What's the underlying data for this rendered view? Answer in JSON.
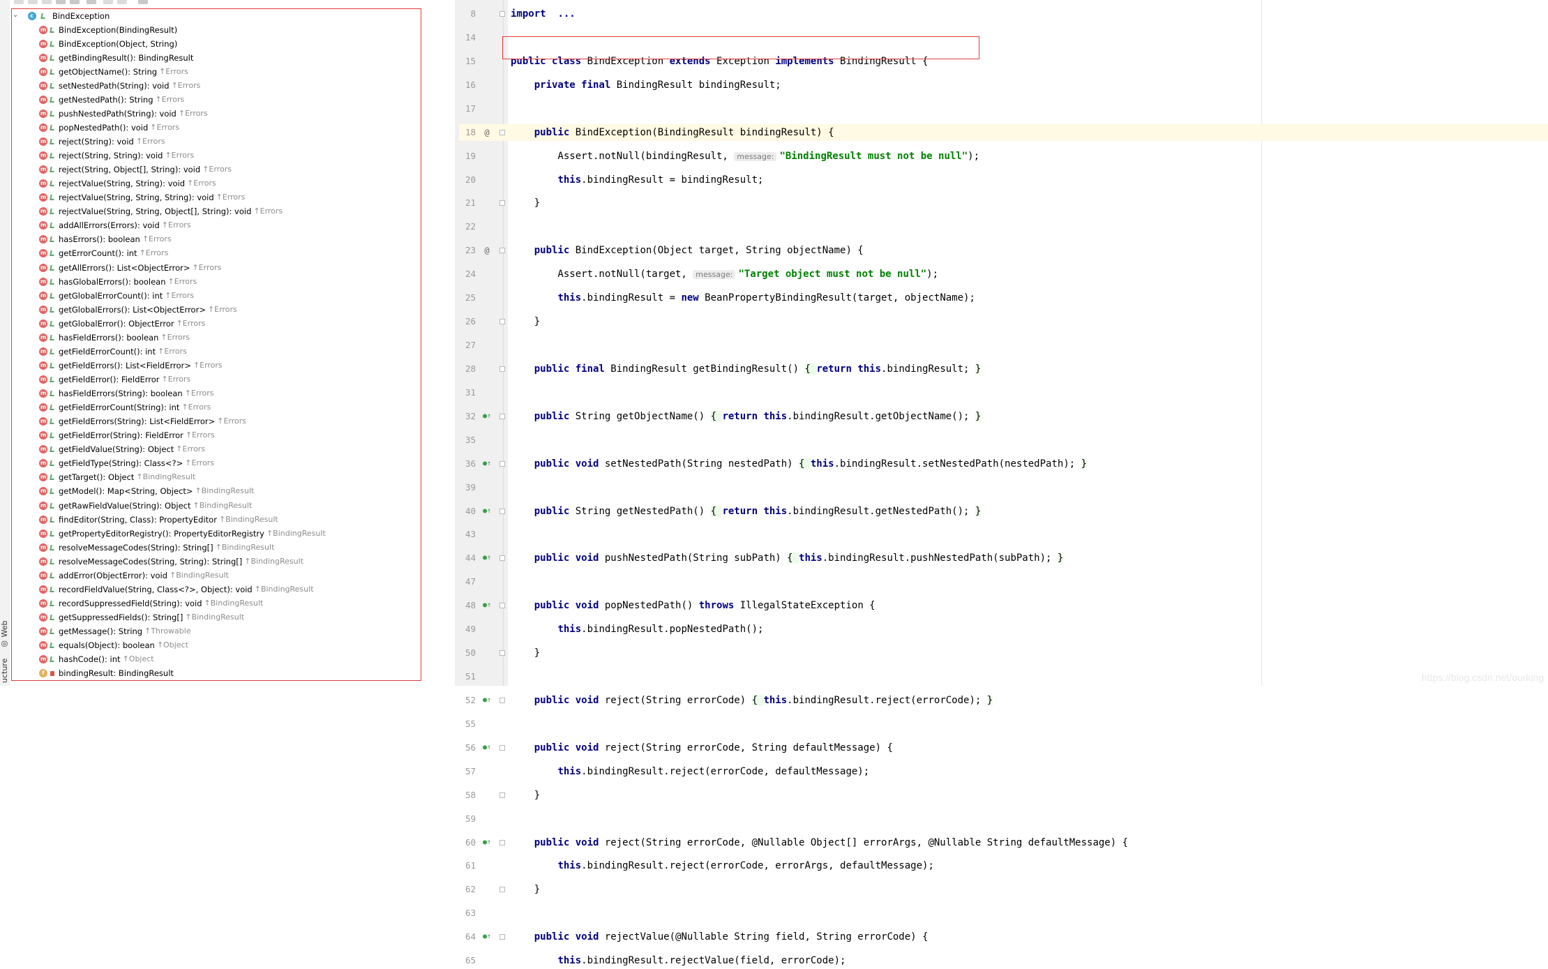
{
  "left_strip": {
    "tabs": [
      "Web",
      "ucture"
    ]
  },
  "structure": {
    "root": {
      "name": "BindException"
    },
    "items": [
      {
        "icon": "method",
        "vis": "public",
        "name": "BindException(BindingResult)",
        "origin": ""
      },
      {
        "icon": "method",
        "vis": "public",
        "name": "BindException(Object, String)",
        "origin": ""
      },
      {
        "icon": "method",
        "vis": "public",
        "name": "getBindingResult(): BindingResult",
        "origin": ""
      },
      {
        "icon": "method",
        "vis": "public",
        "name": "getObjectName(): String",
        "origin": "↑Errors"
      },
      {
        "icon": "method",
        "vis": "public",
        "name": "setNestedPath(String): void",
        "origin": "↑Errors"
      },
      {
        "icon": "method",
        "vis": "public",
        "name": "getNestedPath(): String",
        "origin": "↑Errors"
      },
      {
        "icon": "method",
        "vis": "public",
        "name": "pushNestedPath(String): void",
        "origin": "↑Errors"
      },
      {
        "icon": "method",
        "vis": "public",
        "name": "popNestedPath(): void",
        "origin": "↑Errors"
      },
      {
        "icon": "method",
        "vis": "public",
        "name": "reject(String): void",
        "origin": "↑Errors"
      },
      {
        "icon": "method",
        "vis": "public",
        "name": "reject(String, String): void",
        "origin": "↑Errors"
      },
      {
        "icon": "method",
        "vis": "public",
        "name": "reject(String, Object[], String): void",
        "origin": "↑Errors"
      },
      {
        "icon": "method",
        "vis": "public",
        "name": "rejectValue(String, String): void",
        "origin": "↑Errors"
      },
      {
        "icon": "method",
        "vis": "public",
        "name": "rejectValue(String, String, String): void",
        "origin": "↑Errors"
      },
      {
        "icon": "method",
        "vis": "public",
        "name": "rejectValue(String, String, Object[], String): void",
        "origin": "↑Errors"
      },
      {
        "icon": "method",
        "vis": "public",
        "name": "addAllErrors(Errors): void",
        "origin": "↑Errors"
      },
      {
        "icon": "method",
        "vis": "public",
        "name": "hasErrors(): boolean",
        "origin": "↑Errors"
      },
      {
        "icon": "method",
        "vis": "public",
        "name": "getErrorCount(): int",
        "origin": "↑Errors"
      },
      {
        "icon": "method",
        "vis": "public",
        "name": "getAllErrors(): List<ObjectError>",
        "origin": "↑Errors"
      },
      {
        "icon": "method",
        "vis": "public",
        "name": "hasGlobalErrors(): boolean",
        "origin": "↑Errors"
      },
      {
        "icon": "method",
        "vis": "public",
        "name": "getGlobalErrorCount(): int",
        "origin": "↑Errors"
      },
      {
        "icon": "method",
        "vis": "public",
        "name": "getGlobalErrors(): List<ObjectError>",
        "origin": "↑Errors"
      },
      {
        "icon": "method",
        "vis": "public",
        "name": "getGlobalError(): ObjectError",
        "origin": "↑Errors"
      },
      {
        "icon": "method",
        "vis": "public",
        "name": "hasFieldErrors(): boolean",
        "origin": "↑Errors"
      },
      {
        "icon": "method",
        "vis": "public",
        "name": "getFieldErrorCount(): int",
        "origin": "↑Errors"
      },
      {
        "icon": "method",
        "vis": "public",
        "name": "getFieldErrors(): List<FieldError>",
        "origin": "↑Errors"
      },
      {
        "icon": "method",
        "vis": "public",
        "name": "getFieldError(): FieldError",
        "origin": "↑Errors"
      },
      {
        "icon": "method",
        "vis": "public",
        "name": "hasFieldErrors(String): boolean",
        "origin": "↑Errors"
      },
      {
        "icon": "method",
        "vis": "public",
        "name": "getFieldErrorCount(String): int",
        "origin": "↑Errors"
      },
      {
        "icon": "method",
        "vis": "public",
        "name": "getFieldErrors(String): List<FieldError>",
        "origin": "↑Errors"
      },
      {
        "icon": "method",
        "vis": "public",
        "name": "getFieldError(String): FieldError",
        "origin": "↑Errors"
      },
      {
        "icon": "method",
        "vis": "public",
        "name": "getFieldValue(String): Object",
        "origin": "↑Errors"
      },
      {
        "icon": "method",
        "vis": "public",
        "name": "getFieldType(String): Class<?>",
        "origin": "↑Errors"
      },
      {
        "icon": "method",
        "vis": "public",
        "name": "getTarget(): Object",
        "origin": "↑BindingResult"
      },
      {
        "icon": "method",
        "vis": "public",
        "name": "getModel(): Map<String, Object>",
        "origin": "↑BindingResult"
      },
      {
        "icon": "method",
        "vis": "public",
        "name": "getRawFieldValue(String): Object",
        "origin": "↑BindingResult"
      },
      {
        "icon": "method",
        "vis": "public",
        "name": "findEditor(String, Class): PropertyEditor",
        "origin": "↑BindingResult"
      },
      {
        "icon": "method",
        "vis": "public",
        "name": "getPropertyEditorRegistry(): PropertyEditorRegistry",
        "origin": "↑BindingResult"
      },
      {
        "icon": "method",
        "vis": "public",
        "name": "resolveMessageCodes(String): String[]",
        "origin": "↑BindingResult"
      },
      {
        "icon": "method",
        "vis": "public",
        "name": "resolveMessageCodes(String, String): String[]",
        "origin": "↑BindingResult"
      },
      {
        "icon": "method",
        "vis": "public",
        "name": "addError(ObjectError): void",
        "origin": "↑BindingResult"
      },
      {
        "icon": "method",
        "vis": "public",
        "name": "recordFieldValue(String, Class<?>, Object): void",
        "origin": "↑BindingResult"
      },
      {
        "icon": "method",
        "vis": "public",
        "name": "recordSuppressedField(String): void",
        "origin": "↑BindingResult"
      },
      {
        "icon": "method",
        "vis": "public",
        "name": "getSuppressedFields(): String[]",
        "origin": "↑BindingResult"
      },
      {
        "icon": "method",
        "vis": "public",
        "name": "getMessage(): String",
        "origin": "↑Throwable"
      },
      {
        "icon": "method",
        "vis": "public",
        "name": "equals(Object): boolean",
        "origin": "↑Object"
      },
      {
        "icon": "method",
        "vis": "public",
        "name": "hashCode(): int",
        "origin": "↑Object"
      },
      {
        "icon": "field",
        "vis": "private",
        "name": "bindingResult: BindingResult",
        "origin": ""
      }
    ]
  },
  "editor": {
    "watermark": "https://blog.csdn.net/ourking",
    "lines": [
      {
        "n": "8",
        "slot": 0,
        "g": "",
        "fold": true,
        "tokens": [
          [
            "kw",
            "import"
          ],
          [
            "",
            "  "
          ],
          [
            "kw",
            "..."
          ]
        ]
      },
      {
        "n": "14",
        "slot": 1,
        "g": "",
        "fold": false,
        "tokens": []
      },
      {
        "n": "15",
        "slot": 2,
        "g": "",
        "fold": false,
        "tokens": [
          [
            "kw",
            "public class"
          ],
          [
            "",
            " BindException "
          ],
          [
            "kw",
            "extends"
          ],
          [
            "",
            " Exception "
          ],
          [
            "kw",
            "implements"
          ],
          [
            "",
            " BindingResult {"
          ]
        ]
      },
      {
        "n": "16",
        "slot": 3,
        "g": "",
        "fold": false,
        "tokens": [
          [
            "",
            "    "
          ],
          [
            "kw",
            "private final"
          ],
          [
            "",
            " BindingResult bindingResult;"
          ]
        ]
      },
      {
        "n": "17",
        "slot": 4,
        "g": "",
        "fold": false,
        "tokens": []
      },
      {
        "n": "18",
        "slot": 5,
        "g": "@",
        "fold": true,
        "caret": true,
        "tokens": [
          [
            "",
            "    "
          ],
          [
            "kw",
            "public"
          ],
          [
            "",
            " BindException(BindingResult bindingResult) {"
          ]
        ]
      },
      {
        "n": "19",
        "slot": 6,
        "g": "",
        "fold": false,
        "tokens": [
          [
            "",
            "        Assert.notNull(bindingResult, "
          ],
          [
            "hint",
            "message:"
          ],
          [
            "str",
            "\"BindingResult must not be null\""
          ],
          [
            "",
            ");"
          ]
        ]
      },
      {
        "n": "20",
        "slot": 7,
        "g": "",
        "fold": false,
        "tokens": [
          [
            "",
            "        "
          ],
          [
            "kw",
            "this"
          ],
          [
            "",
            ".bindingResult = bindingResult;"
          ]
        ]
      },
      {
        "n": "21",
        "slot": 8,
        "g": "",
        "fold": true,
        "tokens": [
          [
            "",
            "    }"
          ]
        ]
      },
      {
        "n": "22",
        "slot": 9,
        "g": "",
        "fold": false,
        "tokens": []
      },
      {
        "n": "23",
        "slot": 10,
        "g": "@",
        "fold": true,
        "tokens": [
          [
            "",
            "    "
          ],
          [
            "kw",
            "public"
          ],
          [
            "",
            " BindException(Object target, String objectName) {"
          ]
        ]
      },
      {
        "n": "24",
        "slot": 11,
        "g": "",
        "fold": false,
        "tokens": [
          [
            "",
            "        Assert.notNull(target, "
          ],
          [
            "hint",
            "message:"
          ],
          [
            "str",
            "\"Target object must not be null\""
          ],
          [
            "",
            ");"
          ]
        ]
      },
      {
        "n": "25",
        "slot": 12,
        "g": "",
        "fold": false,
        "tokens": [
          [
            "",
            "        "
          ],
          [
            "kw",
            "this"
          ],
          [
            "",
            ".bindingResult = "
          ],
          [
            "kw",
            "new"
          ],
          [
            "",
            " BeanPropertyBindingResult(target, objectName);"
          ]
        ]
      },
      {
        "n": "26",
        "slot": 13,
        "g": "",
        "fold": true,
        "tokens": [
          [
            "",
            "    }"
          ]
        ]
      },
      {
        "n": "27",
        "slot": 14,
        "g": "",
        "fold": false,
        "tokens": []
      },
      {
        "n": "28",
        "slot": 15,
        "g": "",
        "fold": true,
        "tokens": [
          [
            "",
            "    "
          ],
          [
            "kw",
            "public final"
          ],
          [
            "",
            " BindingResult getBindingResult() "
          ],
          [
            "brace",
            "{ "
          ],
          [
            "kw",
            "return this"
          ],
          [
            "",
            ".bindingResult; "
          ],
          [
            "brace",
            "}"
          ]
        ]
      },
      {
        "n": "31",
        "slot": 16,
        "g": "",
        "fold": false,
        "tokens": []
      },
      {
        "n": "32",
        "slot": 17,
        "g": "impl",
        "fold": true,
        "tokens": [
          [
            "",
            "    "
          ],
          [
            "kw",
            "public"
          ],
          [
            "",
            " String getObjectName() "
          ],
          [
            "brace",
            "{ "
          ],
          [
            "kw",
            "return this"
          ],
          [
            "",
            ".bindingResult.getObjectName(); "
          ],
          [
            "brace",
            "}"
          ]
        ]
      },
      {
        "n": "35",
        "slot": 18,
        "g": "",
        "fold": false,
        "tokens": []
      },
      {
        "n": "36",
        "slot": 19,
        "g": "impl",
        "fold": true,
        "tokens": [
          [
            "",
            "    "
          ],
          [
            "kw",
            "public void"
          ],
          [
            "",
            " setNestedPath(String nestedPath) "
          ],
          [
            "brace",
            "{ "
          ],
          [
            "kw",
            "this"
          ],
          [
            "",
            ".bindingResult.setNestedPath(nestedPath); "
          ],
          [
            "brace",
            "}"
          ]
        ]
      },
      {
        "n": "39",
        "slot": 20,
        "g": "",
        "fold": false,
        "tokens": []
      },
      {
        "n": "40",
        "slot": 21,
        "g": "impl",
        "fold": true,
        "tokens": [
          [
            "",
            "    "
          ],
          [
            "kw",
            "public"
          ],
          [
            "",
            " String getNestedPath() "
          ],
          [
            "brace",
            "{ "
          ],
          [
            "kw",
            "return this"
          ],
          [
            "",
            ".bindingResult.getNestedPath(); "
          ],
          [
            "brace",
            "}"
          ]
        ]
      },
      {
        "n": "43",
        "slot": 22,
        "g": "",
        "fold": false,
        "tokens": []
      },
      {
        "n": "44",
        "slot": 23,
        "g": "impl",
        "fold": true,
        "tokens": [
          [
            "",
            "    "
          ],
          [
            "kw",
            "public void"
          ],
          [
            "",
            " pushNestedPath(String subPath) "
          ],
          [
            "brace",
            "{ "
          ],
          [
            "kw",
            "this"
          ],
          [
            "",
            ".bindingResult.pushNestedPath(subPath); "
          ],
          [
            "brace",
            "}"
          ]
        ]
      },
      {
        "n": "47",
        "slot": 24,
        "g": "",
        "fold": false,
        "tokens": []
      },
      {
        "n": "48",
        "slot": 25,
        "g": "impl",
        "fold": true,
        "tokens": [
          [
            "",
            "    "
          ],
          [
            "kw",
            "public void"
          ],
          [
            "",
            " popNestedPath() "
          ],
          [
            "kw",
            "throws"
          ],
          [
            "",
            " IllegalStateException {"
          ]
        ]
      },
      {
        "n": "49",
        "slot": 26,
        "g": "",
        "fold": false,
        "tokens": [
          [
            "",
            "        "
          ],
          [
            "kw",
            "this"
          ],
          [
            "",
            ".bindingResult.popNestedPath();"
          ]
        ]
      },
      {
        "n": "50",
        "slot": 27,
        "g": "",
        "fold": true,
        "tokens": [
          [
            "",
            "    }"
          ]
        ]
      },
      {
        "n": "51",
        "slot": 28,
        "g": "",
        "fold": false,
        "tokens": []
      },
      {
        "n": "52",
        "slot": 29,
        "g": "impl",
        "fold": true,
        "tokens": [
          [
            "",
            "    "
          ],
          [
            "kw",
            "public void"
          ],
          [
            "",
            " reject(String errorCode) "
          ],
          [
            "brace",
            "{ "
          ],
          [
            "kw",
            "this"
          ],
          [
            "",
            ".bindingResult.reject(errorCode); "
          ],
          [
            "brace",
            "}"
          ]
        ]
      },
      {
        "n": "55",
        "slot": 30,
        "g": "",
        "fold": false,
        "tokens": []
      },
      {
        "n": "56",
        "slot": 31,
        "g": "impl",
        "fold": true,
        "tokens": [
          [
            "",
            "    "
          ],
          [
            "kw",
            "public void"
          ],
          [
            "",
            " reject(String errorCode, String defaultMessage) {"
          ]
        ]
      },
      {
        "n": "57",
        "slot": 32,
        "g": "",
        "fold": false,
        "tokens": [
          [
            "",
            "        "
          ],
          [
            "kw",
            "this"
          ],
          [
            "",
            ".bindingResult.reject(errorCode, defaultMessage);"
          ]
        ]
      },
      {
        "n": "58",
        "slot": 33,
        "g": "",
        "fold": true,
        "tokens": [
          [
            "",
            "    }"
          ]
        ]
      },
      {
        "n": "59",
        "slot": 34,
        "g": "",
        "fold": false,
        "tokens": []
      },
      {
        "n": "60",
        "slot": 35,
        "g": "impl",
        "fold": true,
        "tokens": [
          [
            "",
            "    "
          ],
          [
            "kw",
            "public void"
          ],
          [
            "",
            " reject(String errorCode, @Nullable Object[] errorArgs, @Nullable String defaultMessage) {"
          ]
        ]
      },
      {
        "n": "61",
        "slot": 36,
        "g": "",
        "fold": false,
        "tokens": [
          [
            "",
            "        "
          ],
          [
            "kw",
            "this"
          ],
          [
            "",
            ".bindingResult.reject(errorCode, errorArgs, defaultMessage);"
          ]
        ]
      },
      {
        "n": "62",
        "slot": 37,
        "g": "",
        "fold": true,
        "tokens": [
          [
            "",
            "    }"
          ]
        ]
      },
      {
        "n": "63",
        "slot": 38,
        "g": "",
        "fold": false,
        "tokens": []
      },
      {
        "n": "64",
        "slot": 39,
        "g": "impl",
        "fold": true,
        "tokens": [
          [
            "",
            "    "
          ],
          [
            "kw",
            "public void"
          ],
          [
            "",
            " rejectValue(@Nullable String field, String errorCode) {"
          ]
        ]
      },
      {
        "n": "65",
        "slot": 40,
        "g": "",
        "fold": false,
        "tokens": [
          [
            "",
            "        "
          ],
          [
            "kw",
            "this"
          ],
          [
            "",
            ".bindingResult.rejectValue(field, errorCode);"
          ]
        ]
      }
    ]
  }
}
